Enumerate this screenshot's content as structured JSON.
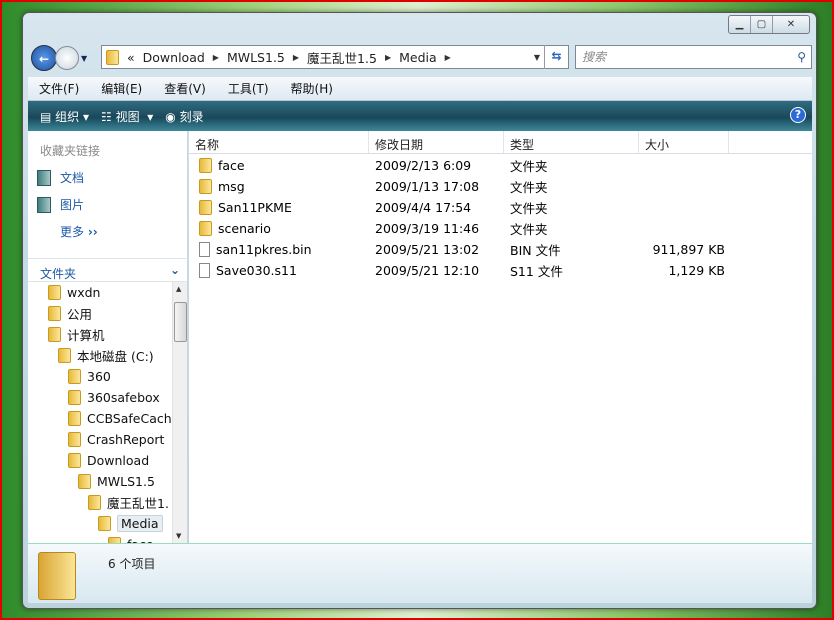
{
  "window": {
    "controls": [
      "minimize",
      "maximize",
      "close"
    ]
  },
  "address": {
    "overflow": "«",
    "crumbs": [
      "Download",
      "MWLS1.5",
      "魔王乱世1.5",
      "Media"
    ],
    "search_placeholder": "搜索"
  },
  "menu": [
    "文件(F)",
    "编辑(E)",
    "查看(V)",
    "工具(T)",
    "帮助(H)"
  ],
  "toolbar": {
    "organize": "组织",
    "views": "视图",
    "burn": "刻录"
  },
  "favorites": {
    "title": "收藏夹链接",
    "items": [
      "文档",
      "图片"
    ],
    "more": "更多"
  },
  "folders": {
    "title": "文件夹",
    "tree": [
      {
        "label": "wxdn",
        "indent": 1
      },
      {
        "label": "公用",
        "indent": 1
      },
      {
        "label": "计算机",
        "indent": 1
      },
      {
        "label": "本地磁盘 (C:)",
        "indent": 2
      },
      {
        "label": "360",
        "indent": 3
      },
      {
        "label": "360safebox",
        "indent": 3
      },
      {
        "label": "CCBSafeCach",
        "indent": 3
      },
      {
        "label": "CrashReport",
        "indent": 3
      },
      {
        "label": "Download",
        "indent": 3
      },
      {
        "label": "MWLS1.5",
        "indent": 4
      },
      {
        "label": "魔王乱世1.",
        "indent": 5
      },
      {
        "label": "Media",
        "indent": 6
      },
      {
        "label": "face",
        "indent": 7
      }
    ]
  },
  "columns": [
    "名称",
    "修改日期",
    "类型",
    "大小"
  ],
  "files": [
    {
      "name": "face",
      "date": "2009/2/13 6:09",
      "type": "文件夹",
      "size": "",
      "folder": true
    },
    {
      "name": "msg",
      "date": "2009/1/13 17:08",
      "type": "文件夹",
      "size": "",
      "folder": true
    },
    {
      "name": "San11PKME",
      "date": "2009/4/4 17:54",
      "type": "文件夹",
      "size": "",
      "folder": true
    },
    {
      "name": "scenario",
      "date": "2009/3/19 11:46",
      "type": "文件夹",
      "size": "",
      "folder": true
    },
    {
      "name": "san11pkres.bin",
      "date": "2009/5/21 13:02",
      "type": "BIN 文件",
      "size": "911,897 KB",
      "folder": false
    },
    {
      "name": "Save030.s11",
      "date": "2009/5/21 12:10",
      "type": "S11 文件",
      "size": "1,129 KB",
      "folder": false
    }
  ],
  "status": {
    "count": "6 个项目"
  }
}
